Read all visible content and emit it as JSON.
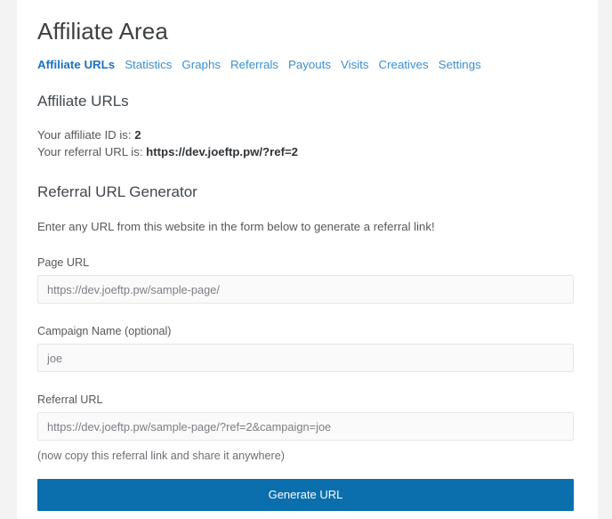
{
  "header": {
    "title": "Affiliate Area"
  },
  "tabs": [
    {
      "label": "Affiliate URLs",
      "active": true
    },
    {
      "label": "Statistics",
      "active": false
    },
    {
      "label": "Graphs",
      "active": false
    },
    {
      "label": "Referrals",
      "active": false
    },
    {
      "label": "Payouts",
      "active": false
    },
    {
      "label": "Visits",
      "active": false
    },
    {
      "label": "Creatives",
      "active": false
    },
    {
      "label": "Settings",
      "active": false
    }
  ],
  "affiliate_urls": {
    "heading": "Affiliate URLs",
    "id_label": "Your affiliate ID is:",
    "id_value": "2",
    "referral_label": "Your referral URL is:",
    "referral_value": "https://dev.joeftp.pw/?ref=2"
  },
  "generator": {
    "heading": "Referral URL Generator",
    "intro": "Enter any URL from this website in the form below to generate a referral link!",
    "fields": [
      {
        "label": "Page URL",
        "value": "https://dev.joeftp.pw/sample-page/",
        "placeholder": "https://dev.joeftp.pw/sample-page/"
      },
      {
        "label": "Campaign Name (optional)",
        "value": "joe",
        "placeholder": "joe"
      },
      {
        "label": "Referral URL",
        "value": "https://dev.joeftp.pw/sample-page/?ref=2&campaign=joe",
        "placeholder": "https://dev.joeftp.pw/sample-page/?ref=2&campaign=joe"
      }
    ],
    "helper_text": "(now copy this referral link and share it anywhere)",
    "submit_label": "Generate URL"
  },
  "colors": {
    "accent": "#0b6ead",
    "link": "#3a8fd1",
    "link_active": "#1a72c4",
    "page_background": "#f3f3f4",
    "sheet_background": "#ffffff"
  }
}
